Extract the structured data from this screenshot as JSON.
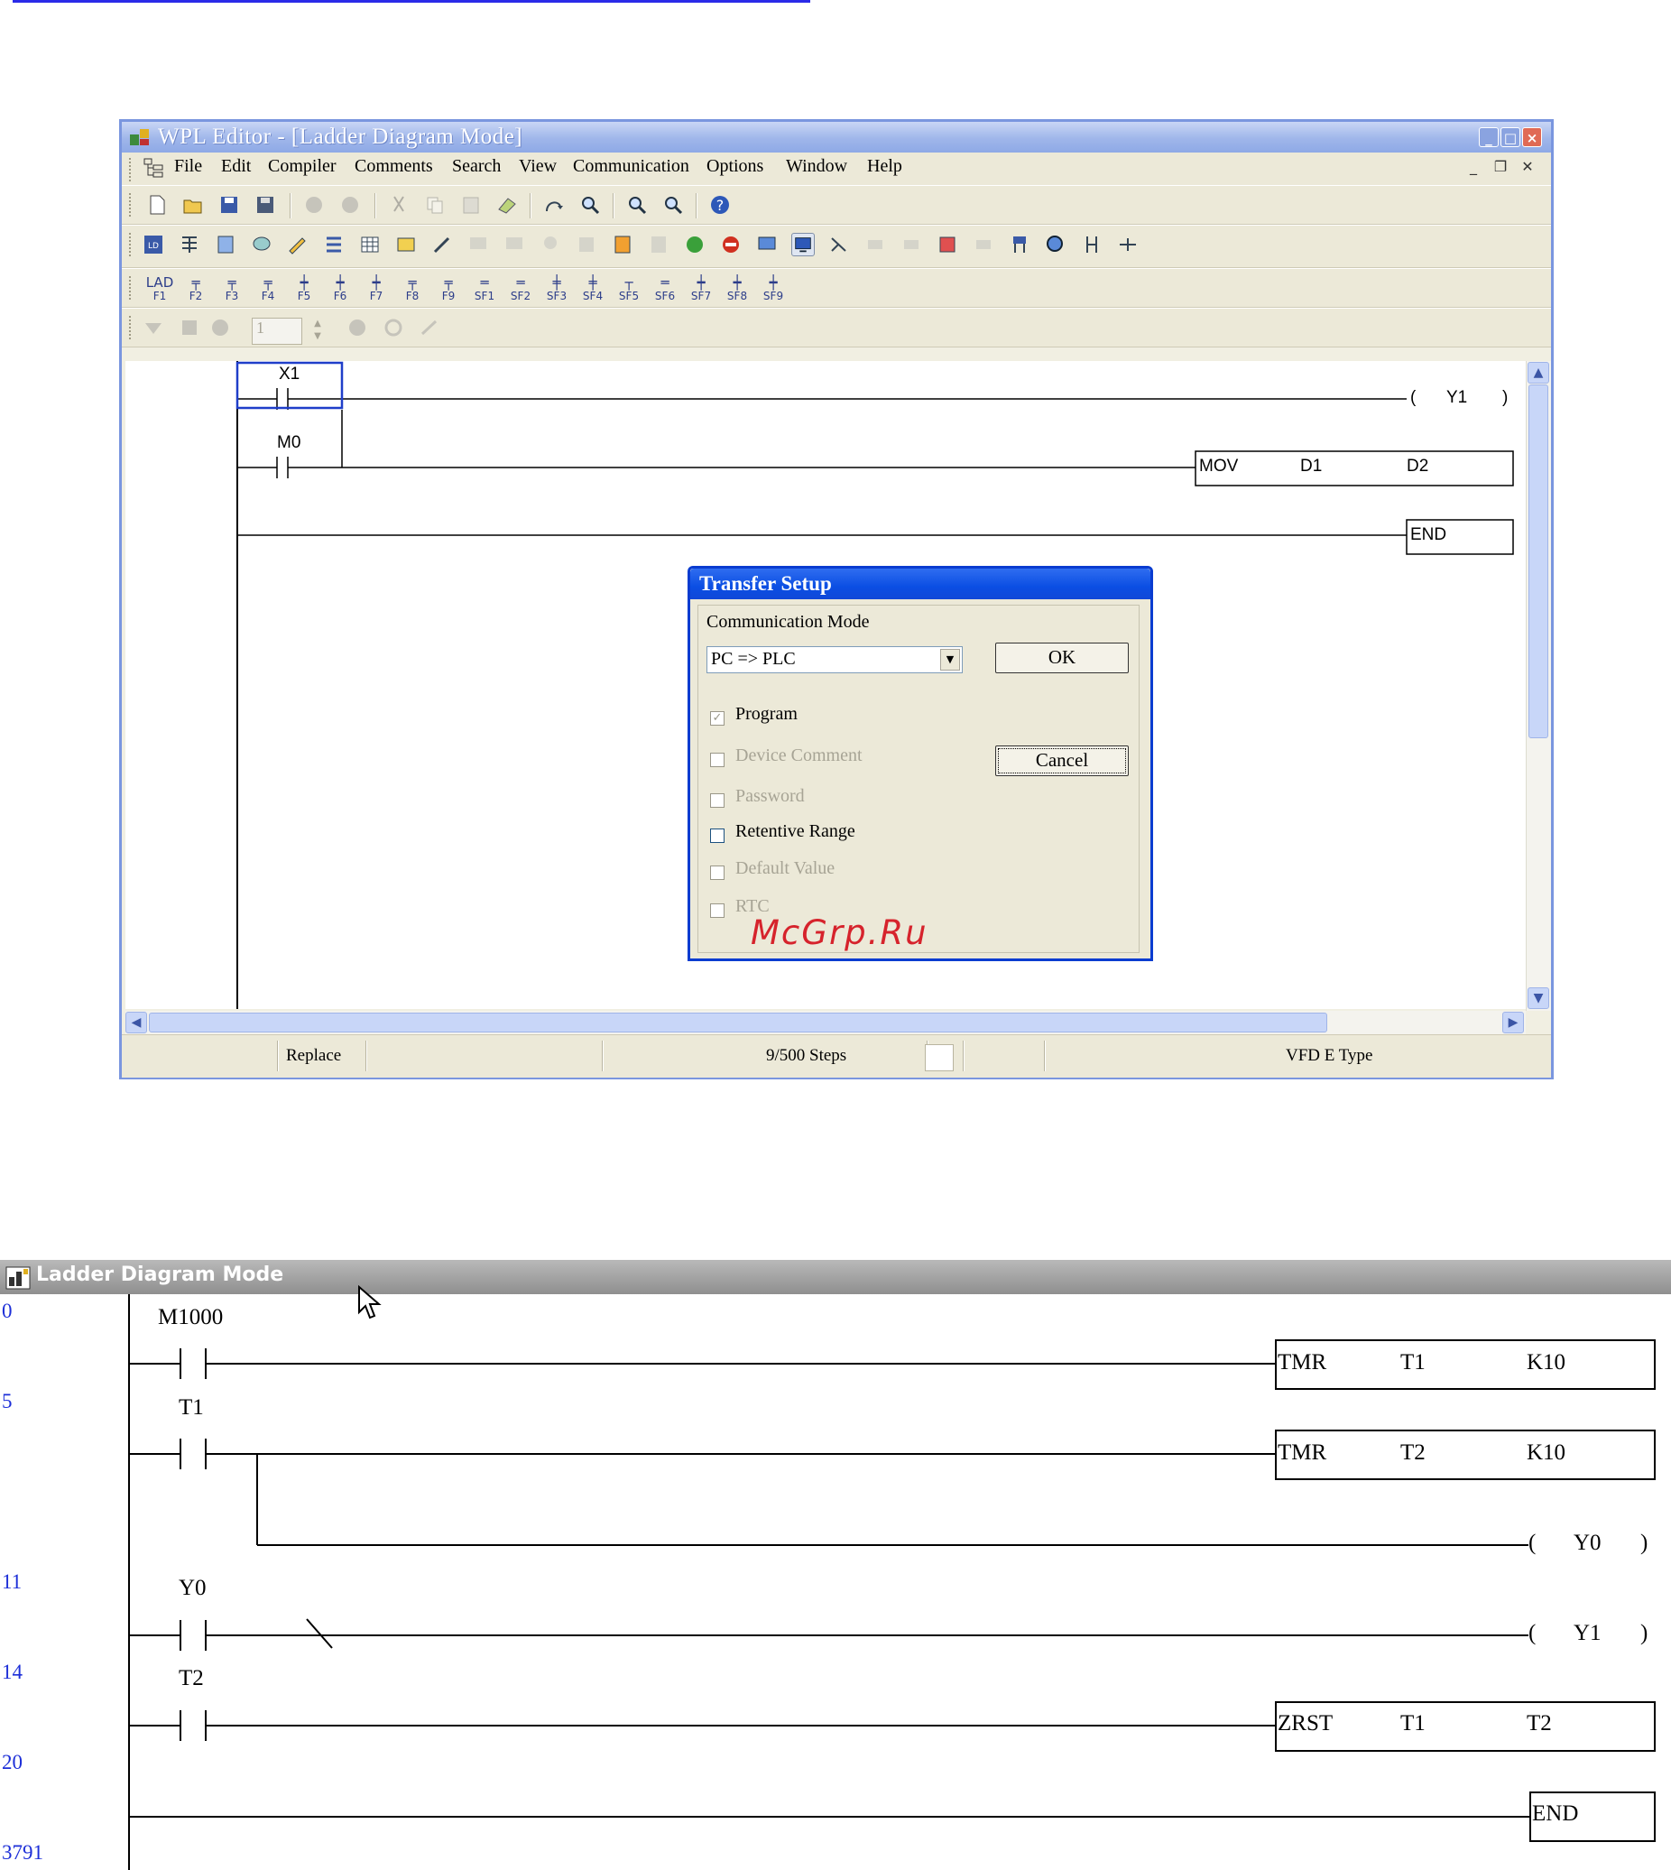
{
  "window": {
    "title": "WPL Editor - [Ladder Diagram Mode]",
    "title_buttons": [
      "_",
      "□",
      "×"
    ],
    "menu": [
      "File",
      "Edit",
      "Compiler",
      "Comments",
      "Search",
      "View",
      "Communication",
      "Options",
      "Window",
      "Help"
    ],
    "mdi_buttons": [
      "_",
      "❐",
      "✕"
    ],
    "fkeys": [
      {
        "sym": "LAD",
        "label": "F1"
      },
      {
        "sym": "╤",
        "label": "F2"
      },
      {
        "sym": "╤",
        "label": "F3"
      },
      {
        "sym": "╤",
        "label": "F4"
      },
      {
        "sym": "┿",
        "label": "F5"
      },
      {
        "sym": "┿",
        "label": "F6"
      },
      {
        "sym": "┿",
        "label": "F7"
      },
      {
        "sym": "╤",
        "label": "F8"
      },
      {
        "sym": "╤",
        "label": "F9"
      },
      {
        "sym": "═",
        "label": "SF1"
      },
      {
        "sym": "═",
        "label": "SF2"
      },
      {
        "sym": "╪",
        "label": "SF3"
      },
      {
        "sym": "╪",
        "label": "SF4"
      },
      {
        "sym": "┬",
        "label": "SF5"
      },
      {
        "sym": "═",
        "label": "SF6"
      },
      {
        "sym": "┿",
        "label": "SF7"
      },
      {
        "sym": "┿",
        "label": "SF8"
      },
      {
        "sym": "┿",
        "label": "SF9"
      }
    ],
    "row4_input": "1",
    "status": {
      "mode": "Replace",
      "steps": "9/500 Steps",
      "type": "VFD E Type"
    },
    "ladder": {
      "x1": "X1",
      "m0": "M0",
      "y1_open": "(",
      "y1": "Y1",
      "y1_close": ")",
      "mov": "MOV",
      "d1": "D1",
      "d2": "D2",
      "end": "END"
    }
  },
  "dialog": {
    "title": "Transfer Setup",
    "mode_label": "Communication Mode",
    "mode_value": "PC => PLC",
    "ok": "OK",
    "cancel": "Cancel",
    "checks": [
      {
        "label": "Program",
        "checked": true,
        "enabled": false
      },
      {
        "label": "Device Comment",
        "checked": false,
        "enabled": false
      },
      {
        "label": "Password",
        "checked": false,
        "enabled": false
      },
      {
        "label": "Retentive Range",
        "checked": false,
        "enabled": true
      },
      {
        "label": "Default Value",
        "checked": false,
        "enabled": false
      },
      {
        "label": "RTC",
        "checked": false,
        "enabled": false
      }
    ]
  },
  "watermark": "McGrp.Ru",
  "ladder2": {
    "title": "Ladder Diagram Mode",
    "steps": [
      "0",
      "5",
      "11",
      "14",
      "20",
      "3791"
    ],
    "m1000": "M1000",
    "tmr1": {
      "op": "TMR",
      "a": "T1",
      "b": "K10"
    },
    "t1": "T1",
    "tmr2": {
      "op": "TMR",
      "a": "T2",
      "b": "K10"
    },
    "y0_coil": {
      "open": "(",
      "name": "Y0",
      "close": ")"
    },
    "y0": "Y0",
    "y1_coil": {
      "open": "(",
      "name": "Y1",
      "close": ")"
    },
    "t2": "T2",
    "zrst": {
      "op": "ZRST",
      "a": "T1",
      "b": "T2"
    },
    "end": "END"
  }
}
